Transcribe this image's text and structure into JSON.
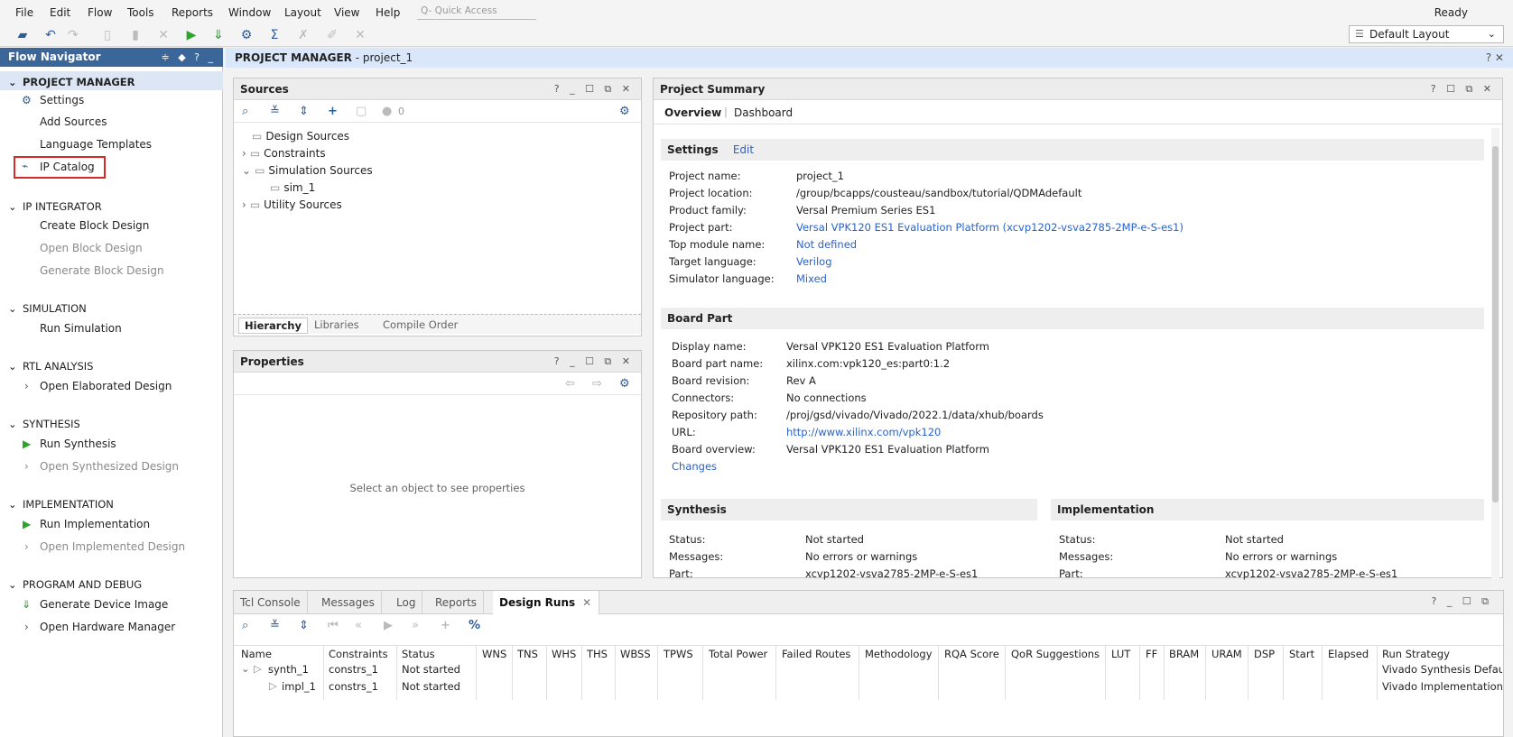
{
  "menu": [
    "File",
    "Edit",
    "Flow",
    "Tools",
    "Reports",
    "Window",
    "Layout",
    "View",
    "Help"
  ],
  "quick_access_placeholder": "Q- Quick Access",
  "status": "Ready",
  "layout_select": "Default Layout",
  "flow_nav": {
    "title": "Flow Navigator",
    "controls": "≑ ◆ ? _",
    "sections": {
      "pm": {
        "label": "PROJECT MANAGER",
        "items": [
          "Settings",
          "Add Sources",
          "Language Templates",
          "IP Catalog"
        ]
      },
      "ipi": {
        "label": "IP INTEGRATOR",
        "items": [
          "Create Block Design",
          "Open Block Design",
          "Generate Block Design"
        ]
      },
      "sim": {
        "label": "SIMULATION",
        "items": [
          "Run Simulation"
        ]
      },
      "rtl": {
        "label": "RTL ANALYSIS",
        "items": [
          "Open Elaborated Design"
        ]
      },
      "syn": {
        "label": "SYNTHESIS",
        "items": [
          "Run Synthesis",
          "Open Synthesized Design"
        ]
      },
      "impl": {
        "label": "IMPLEMENTATION",
        "items": [
          "Run Implementation",
          "Open Implemented Design"
        ]
      },
      "pgm": {
        "label": "PROGRAM AND DEBUG",
        "items": [
          "Generate Device Image",
          "Open Hardware Manager"
        ]
      }
    }
  },
  "header": {
    "bold": "PROJECT MANAGER",
    "rest": " - project_1",
    "controls": "? ✕"
  },
  "sources": {
    "title": "Sources",
    "controls": "? _ ☐ ⧉ ✕",
    "count": "0",
    "tree": [
      "Design Sources",
      "Constraints",
      "Simulation Sources",
      "sim_1",
      "Utility Sources"
    ],
    "tabs": [
      "Hierarchy",
      "Libraries",
      "Compile Order"
    ]
  },
  "properties": {
    "title": "Properties",
    "controls": "? _ ☐ ⧉ ✕",
    "empty": "Select an object to see properties"
  },
  "summary": {
    "title": "Project Summary",
    "controls": "? ☐ ⧉ ✕",
    "tabs": [
      "Overview",
      "Dashboard"
    ],
    "settings": {
      "title": "Settings",
      "edit": "Edit",
      "rows": [
        {
          "k": "Project name:",
          "v": "project_1"
        },
        {
          "k": "Project location:",
          "v": "/group/bcapps/cousteau/sandbox/tutorial/QDMAdefault"
        },
        {
          "k": "Product family:",
          "v": "Versal Premium Series ES1"
        },
        {
          "k": "Project part:",
          "v": "Versal VPK120 ES1 Evaluation Platform (xcvp1202-vsva2785-2MP-e-S-es1)"
        },
        {
          "k": "Top module name:",
          "v": "Not defined"
        },
        {
          "k": "Target language:",
          "v": "Verilog"
        },
        {
          "k": "Simulator language:",
          "v": "Mixed"
        }
      ]
    },
    "board": {
      "title": "Board Part",
      "rows": [
        {
          "k": "Display name:",
          "v": "Versal VPK120 ES1 Evaluation Platform"
        },
        {
          "k": "Board part name:",
          "v": "xilinx.com:vpk120_es:part0:1.2"
        },
        {
          "k": "Board revision:",
          "v": "Rev A"
        },
        {
          "k": "Connectors:",
          "v": "No connections"
        },
        {
          "k": "Repository path:",
          "v": "/proj/gsd/vivado/Vivado/2022.1/data/xhub/boards"
        },
        {
          "k": "URL:",
          "v": "http://www.xilinx.com/vpk120"
        },
        {
          "k": "Board overview:",
          "v": "Versal VPK120 ES1 Evaluation Platform"
        }
      ],
      "changes": "Changes"
    },
    "synthesis": {
      "title": "Synthesis",
      "rows": [
        {
          "k": "Status:",
          "v": "Not started"
        },
        {
          "k": "Messages:",
          "v": "No errors or warnings"
        },
        {
          "k": "Part:",
          "v": "xcvp1202-vsva2785-2MP-e-S-es1"
        }
      ]
    },
    "implementation": {
      "title": "Implementation",
      "rows": [
        {
          "k": "Status:",
          "v": "Not started"
        },
        {
          "k": "Messages:",
          "v": "No errors or warnings"
        },
        {
          "k": "Part:",
          "v": "xcvp1202-vsva2785-2MP-e-S-es1"
        }
      ]
    }
  },
  "bottom": {
    "tabs": [
      "Tcl Console",
      "Messages",
      "Log",
      "Reports",
      "Design Runs"
    ],
    "controls": "? _ ☐ ⧉",
    "columns": [
      "Name",
      "Constraints",
      "Status",
      "WNS",
      "TNS",
      "WHS",
      "THS",
      "WBSS",
      "TPWS",
      "Total Power",
      "Failed Routes",
      "Methodology",
      "RQA Score",
      "QoR Suggestions",
      "LUT",
      "FF",
      "BRAM",
      "URAM",
      "DSP",
      "Start",
      "Elapsed",
      "Run Strategy"
    ],
    "rows": [
      {
        "name": "synth_1",
        "constraints": "constrs_1",
        "status": "Not started",
        "strategy": "Vivado Synthesis Defau"
      },
      {
        "name": "impl_1",
        "constraints": "constrs_1",
        "status": "Not started",
        "strategy": "Vivado Implementation"
      }
    ]
  }
}
